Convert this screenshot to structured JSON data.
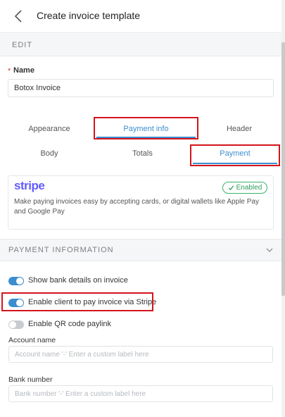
{
  "header": {
    "title": "Create invoice template",
    "back_icon": "chevron-left-icon"
  },
  "edit_section": {
    "label": "EDIT"
  },
  "name_field": {
    "required_mark": "*",
    "label": "Name",
    "value": "Botox Invoice"
  },
  "tabs_row1": [
    {
      "label": "Appearance",
      "active": false
    },
    {
      "label": "Payment info",
      "active": true
    },
    {
      "label": "Header",
      "active": false
    }
  ],
  "tabs_row2": [
    {
      "label": "Body",
      "active": false
    },
    {
      "label": "Totals",
      "active": false
    },
    {
      "label": "Payment",
      "active": true
    }
  ],
  "stripe_card": {
    "logo": "stripe",
    "badge": "Enabled",
    "badge_icon": "check-icon",
    "description": "Make paying invoices easy by accepting cards, or digital wallets like Apple Pay and Google Pay"
  },
  "payment_information": {
    "label": "PAYMENT INFORMATION",
    "chevron_icon": "chevron-down-icon",
    "toggles": [
      {
        "label": "Show bank details on invoice",
        "on": true
      },
      {
        "label": "Enable client to pay invoice via Stripe",
        "on": true
      },
      {
        "label": "Enable QR code paylink",
        "on": false
      }
    ],
    "account_name": {
      "label": "Account name",
      "placeholder": "Account name '-' Enter a custom label here"
    },
    "bank_number": {
      "label": "Bank number",
      "placeholder": "Bank number '-' Enter a custom label here"
    }
  },
  "colors": {
    "accent": "#3b8ed0",
    "highlight_box": "#d4141c",
    "stripe_brand": "#635bff",
    "enabled_green": "#39b26b"
  }
}
